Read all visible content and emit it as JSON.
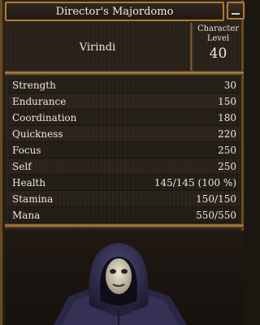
{
  "window": {
    "title": "Director's Majordomo"
  },
  "header": {
    "name": "Virindi",
    "level_label": "Character\nLevel",
    "level_value": "40"
  },
  "stats": [
    {
      "name": "Strength",
      "value": "30"
    },
    {
      "name": "Endurance",
      "value": "150"
    },
    {
      "name": "Coordination",
      "value": "180"
    },
    {
      "name": "Quickness",
      "value": "220"
    },
    {
      "name": "Focus",
      "value": "250"
    },
    {
      "name": "Self",
      "value": "250"
    },
    {
      "name": "Health",
      "value": "145/145 (100 %)"
    },
    {
      "name": "Stamina",
      "value": "150/150"
    },
    {
      "name": "Mana",
      "value": "550/550"
    }
  ],
  "colors": {
    "frame_gold": "#b07a2e",
    "panel_bg": "#2a231c",
    "robe": "#34304e",
    "mask": "#d8d2bc"
  },
  "icons": {
    "close": "minimize-icon"
  }
}
